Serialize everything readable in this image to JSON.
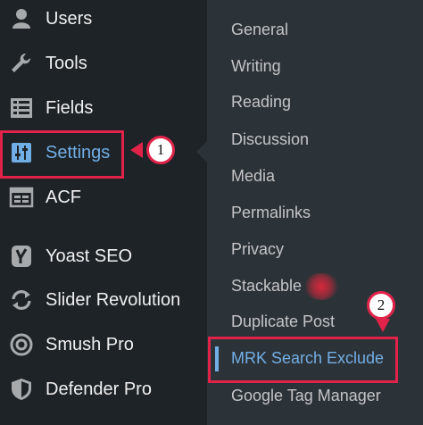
{
  "sidebar": {
    "items": [
      {
        "label": "Users",
        "icon": "user-icon"
      },
      {
        "label": "Tools",
        "icon": "wrench-icon"
      },
      {
        "label": "Fields",
        "icon": "list-icon"
      },
      {
        "label": "Settings",
        "icon": "sliders-icon",
        "active": true
      },
      {
        "label": "ACF",
        "icon": "grid-icon"
      },
      {
        "label": "Yoast SEO",
        "icon": "yoast-icon"
      },
      {
        "label": "Slider Revolution",
        "icon": "refresh-icon"
      },
      {
        "label": "Smush Pro",
        "icon": "smush-icon"
      },
      {
        "label": "Defender Pro",
        "icon": "shield-icon"
      }
    ]
  },
  "submenu": {
    "items": [
      {
        "label": "General"
      },
      {
        "label": "Writing"
      },
      {
        "label": "Reading"
      },
      {
        "label": "Discussion"
      },
      {
        "label": "Media"
      },
      {
        "label": "Permalinks"
      },
      {
        "label": "Privacy"
      },
      {
        "label": "Stackable"
      },
      {
        "label": "Duplicate Post"
      },
      {
        "label": "MRK Search Exclude",
        "active": true
      },
      {
        "label": "Google Tag Manager"
      }
    ]
  },
  "callouts": {
    "settings": "1",
    "mrk": "2"
  },
  "colors": {
    "sidebar_bg": "#1d2327",
    "submenu_bg": "#2c3338",
    "active": "#72aee6",
    "highlight": "#e1234a"
  }
}
